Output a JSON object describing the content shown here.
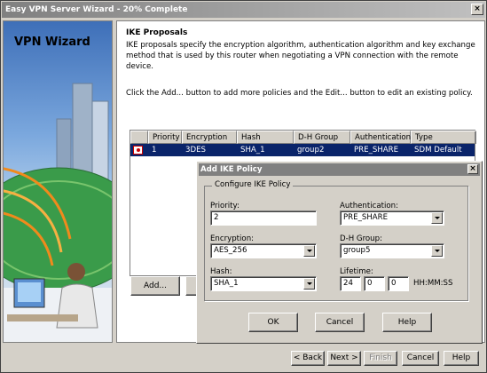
{
  "window": {
    "title": "Easy VPN Server Wizard - 20% Complete"
  },
  "left": {
    "title": "VPN Wizard"
  },
  "main": {
    "heading": "IKE Proposals",
    "description": "IKE proposals specify the encryption algorithm, authentication algorithm and key exchange method that is used by this router when negotiating a VPN connection with the remote device.",
    "instruction": "Click the Add... button to add more policies and the Edit... button to edit an existing policy."
  },
  "table": {
    "columns": [
      "Priority",
      "Encryption",
      "Hash",
      "D-H Group",
      "Authentication",
      "Type"
    ],
    "rows": [
      {
        "icon": "policy-icon",
        "priority": "1",
        "encryption": "3DES",
        "hash": "SHA_1",
        "dh_group": "group2",
        "authentication": "PRE_SHARE",
        "type": "SDM Default"
      }
    ]
  },
  "buttons": {
    "add": "Add...",
    "back": "< Back",
    "next": "Next >",
    "finish": "Finish",
    "cancel": "Cancel",
    "help": "Help"
  },
  "dialog": {
    "title": "Add IKE Policy",
    "group_label": "Configure IKE Policy",
    "priority_label": "Priority:",
    "priority_value": "2",
    "authentication_label": "Authentication:",
    "authentication_value": "PRE_SHARE",
    "encryption_label": "Encryption:",
    "encryption_value": "AES_256",
    "dh_group_label": "D-H Group:",
    "dh_group_value": "group5",
    "hash_label": "Hash:",
    "hash_value": "SHA_1",
    "lifetime_label": "Lifetime:",
    "lifetime_hours": "24",
    "lifetime_minutes": "0",
    "lifetime_seconds": "0",
    "lifetime_format": "HH:MM:SS",
    "ok": "OK",
    "cancel": "Cancel",
    "help": "Help"
  },
  "colors": {
    "selection": "#0a246a",
    "titlebar": "#808080",
    "face": "#d4d0c8"
  }
}
